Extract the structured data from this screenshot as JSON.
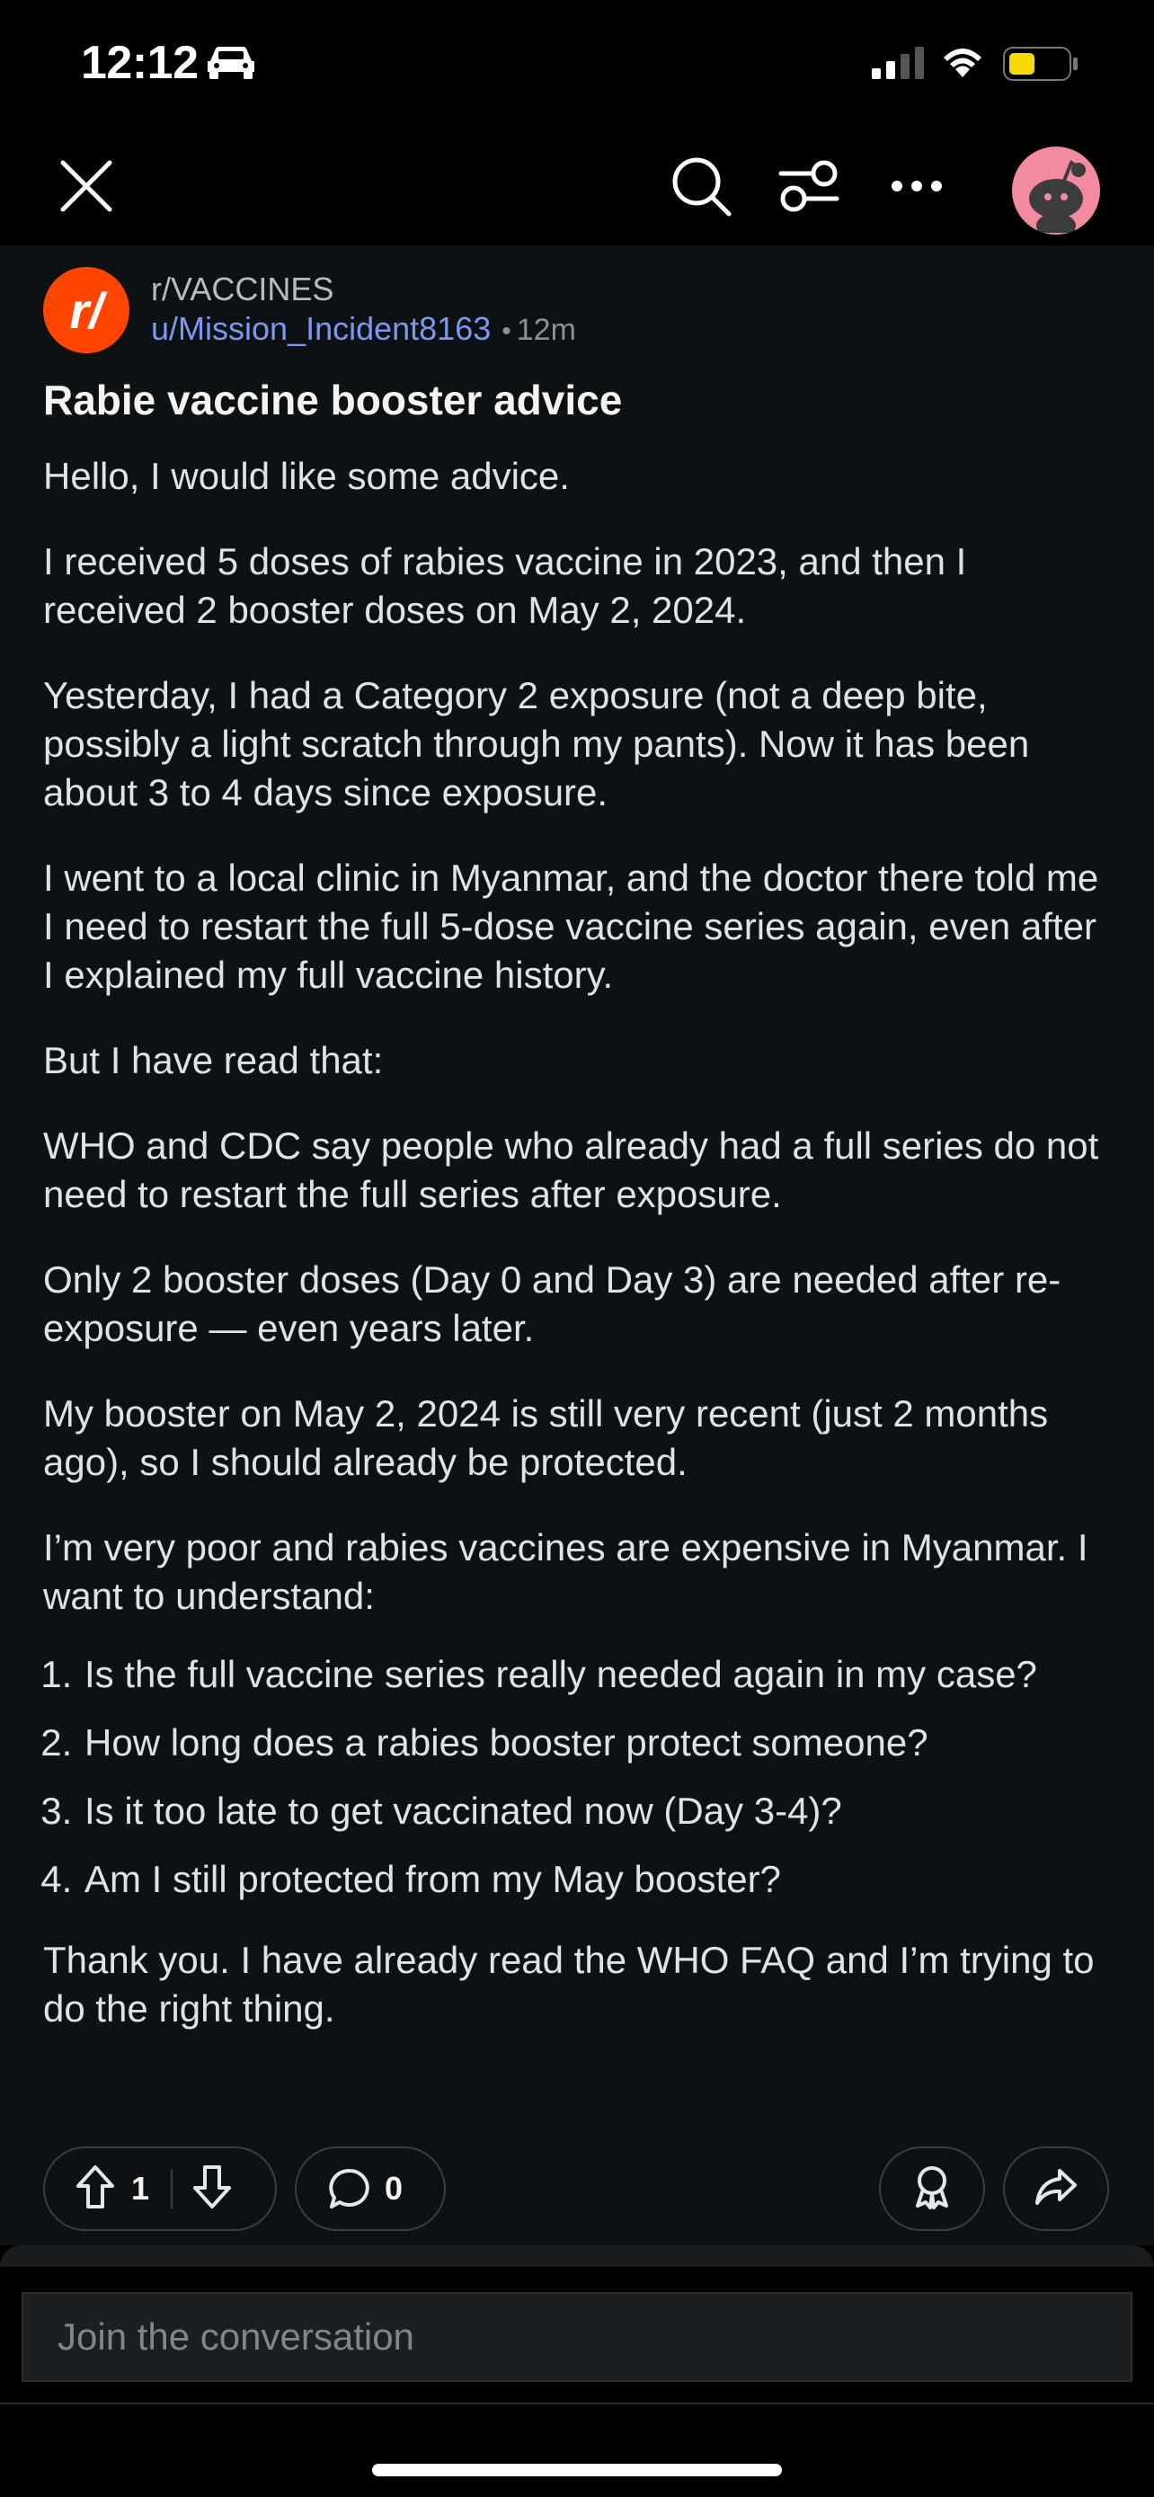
{
  "status_bar": {
    "time": "12:12"
  },
  "subreddit": {
    "name": "r/VACCINES",
    "icon_letter": "r/"
  },
  "post": {
    "author": "u/Mission_Incident8163",
    "age": "12m",
    "title": "Rabie vaccine booster advice",
    "body": {
      "p1": "Hello, I would like some advice.",
      "p2": "I received 5 doses of rabies vaccine in 2023, and then I received 2 booster doses on May 2, 2024.",
      "p3": "Yesterday, I had a Category 2 exposure (not a deep bite, possibly a light scratch through my pants). Now it has been about 3 to 4 days since exposure.",
      "p4": "I went to a local clinic in Myanmar, and the doctor there told me I need to restart the full 5-dose vaccine series again, even after I explained my full vaccine history.",
      "p5": "But I have read that:",
      "p6": "WHO and CDC say people who already had a full series do not need to restart the full series after exposure.",
      "p7": "Only 2 booster doses (Day 0 and Day 3) are needed after re-exposure — even years later.",
      "p8": "My booster on May 2, 2024 is still very recent (just 2 months ago), so I should already be protected.",
      "p9": "I’m very poor and rabies vaccines are expensive in Myanmar. I want to understand:",
      "list": [
        "Is the full vaccine series really needed again in my case?",
        "How long does a rabies booster protect someone?",
        "Is it too late to get vaccinated now (Day 3-4)?",
        "Am I still protected from my May booster?"
      ],
      "p10": "Thank you. I have already read the WHO FAQ and I’m trying to do the right thing."
    },
    "votes": "1",
    "comments": "0"
  },
  "composer": {
    "placeholder": "Join the conversation"
  },
  "colors": {
    "background": "#0e1113",
    "username": "#7c98f3",
    "subreddit_icon": "#ff4500",
    "avatar": "#f38ba0",
    "battery": "#f5d90a"
  }
}
